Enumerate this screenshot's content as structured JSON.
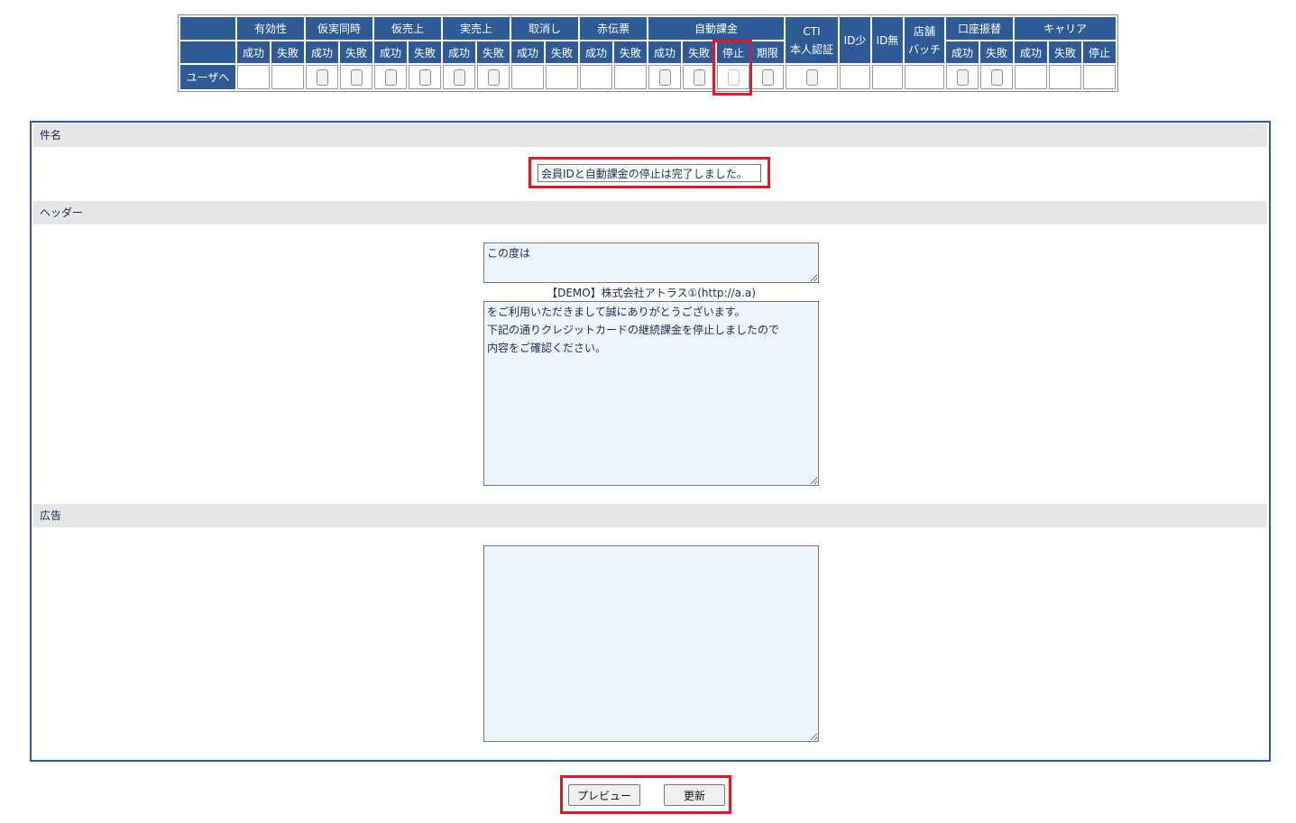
{
  "matrix": {
    "group_headers": [
      "有効性",
      "仮実同時",
      "仮売上",
      "実売上",
      "取消し",
      "赤伝票",
      "自動課金",
      "CTI 本人認証",
      "ID少",
      "ID無",
      "店舗 バッチ",
      "口座振替",
      "キャリア"
    ],
    "sub_headers": {
      "success": "成功",
      "fail": "失敗",
      "stop": "停止",
      "expiry": "期限"
    },
    "row_label": "ユーザへ"
  },
  "panel": {
    "subject_label": "件名",
    "subject_value": "会員IDと自動課金の停止は完了しました。",
    "header_label": "ヘッダー",
    "header_top_text": "この度は",
    "company_line": "【DEMO】株式会社アトラス①(http://a.a)",
    "header_body_text": "をご利用いただきまして誠にありがとうございます。\n下記の通りクレジットカードの継続課金を停止しましたので\n内容をご確認ください。",
    "ad_label": "広告",
    "ad_text": ""
  },
  "buttons": {
    "preview": "プレビュー",
    "update": "更新"
  },
  "colors": {
    "header_blue": "#2e5b96",
    "highlight_red": "#e3172a",
    "textarea_bg": "#eef5ff"
  }
}
